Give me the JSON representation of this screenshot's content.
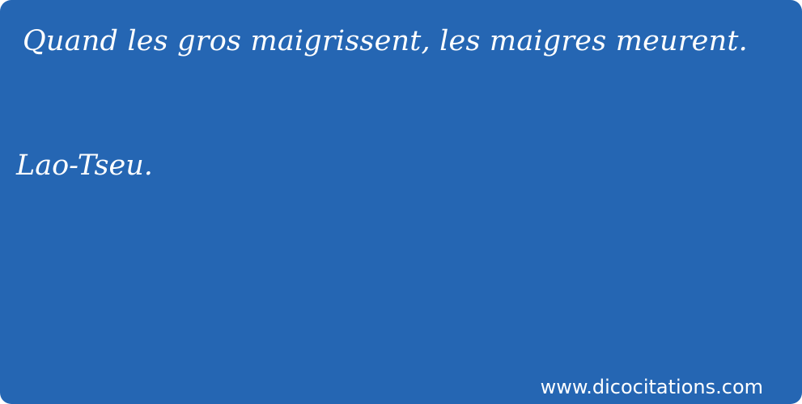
{
  "card": {
    "background_color": "#2566b3",
    "text_color": "#ffffff"
  },
  "quote": {
    "text": "Quand les gros maigrissent, les maigres meurent.",
    "author": "Lao-Tseu."
  },
  "footer": {
    "site": "www.dicocitations.com"
  }
}
